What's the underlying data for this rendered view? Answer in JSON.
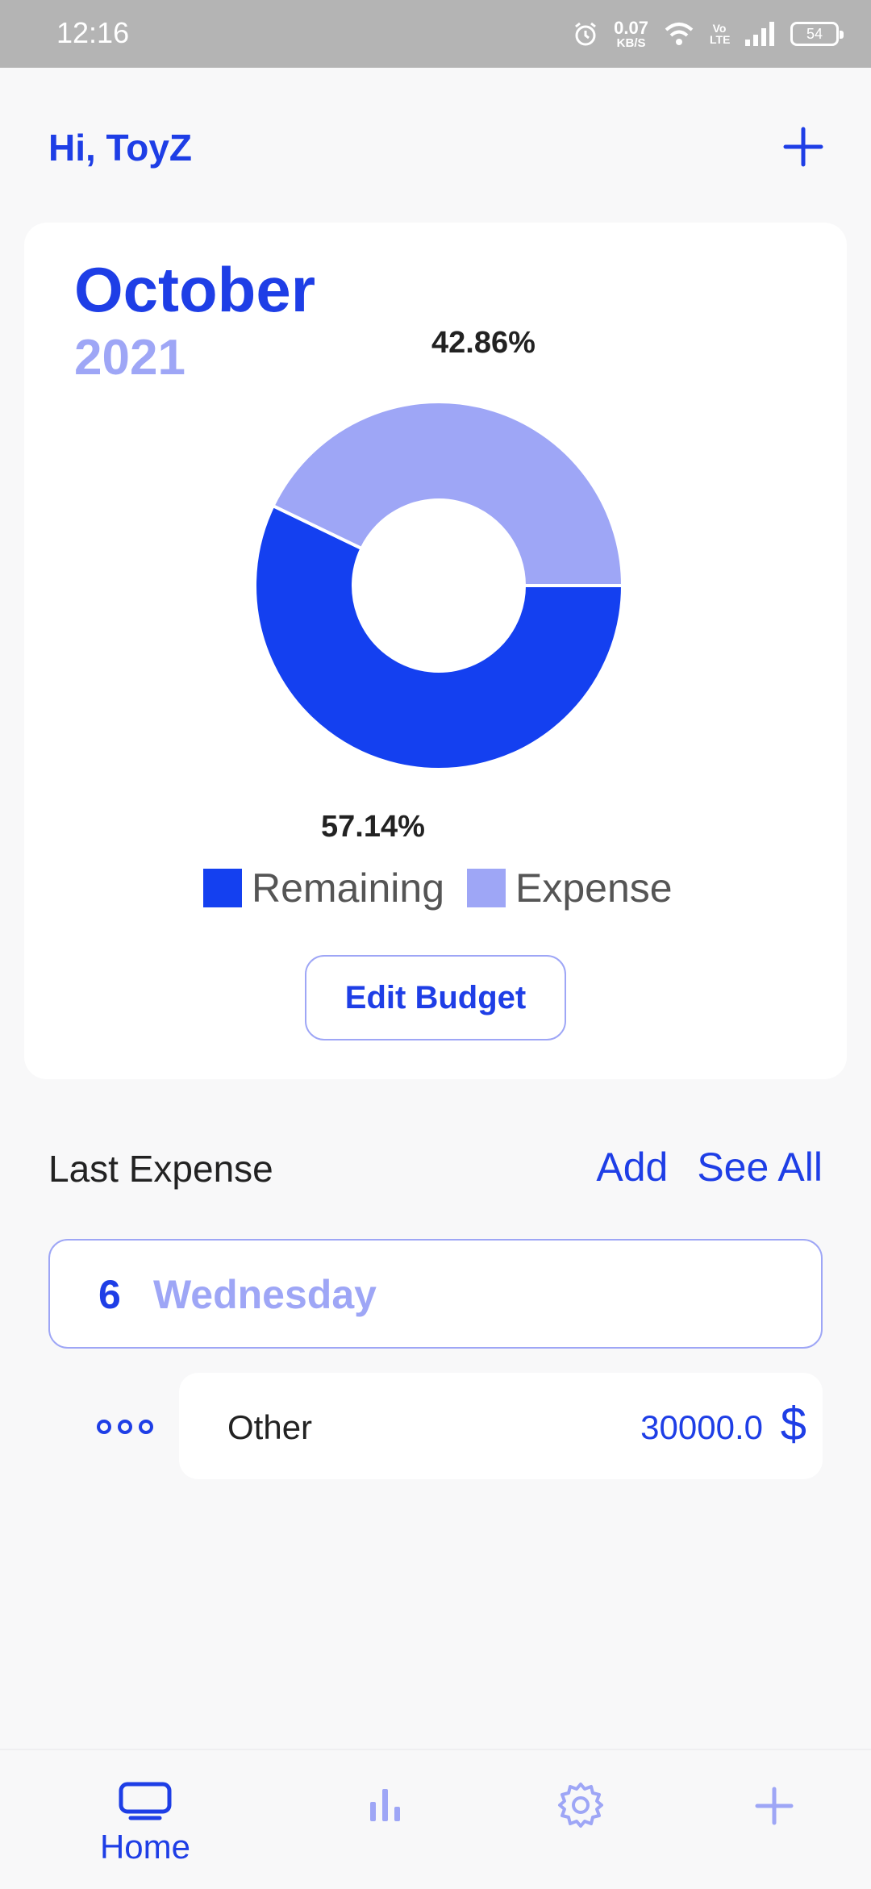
{
  "status_bar": {
    "time": "12:16",
    "net_speed_value": "0.07",
    "net_speed_unit": "KB/S",
    "network_label": "Vo LTE",
    "battery": "54"
  },
  "header": {
    "greeting": "Hi, ToyZ",
    "add_icon": "plus-icon"
  },
  "budget": {
    "month": "October",
    "year": "2021",
    "chart_data": {
      "type": "pie",
      "donut": true,
      "categories": [
        "Remaining",
        "Expense"
      ],
      "values": [
        57.14,
        42.86
      ],
      "labels": [
        "57.14%",
        "42.86%"
      ],
      "colors": [
        "#1440f0",
        "#9ea6f6"
      ],
      "legend_position": "bottom"
    },
    "legend": [
      {
        "label": "Remaining",
        "color": "#1440f0"
      },
      {
        "label": "Expense",
        "color": "#9ea6f6"
      }
    ],
    "edit_button": "Edit Budget"
  },
  "last_expense": {
    "title": "Last Expense",
    "add_label": "Add",
    "see_all_label": "See All",
    "day": {
      "number": "6",
      "name": "Wednesday"
    },
    "items": [
      {
        "category": "Other",
        "amount": "30000.0",
        "currency": "$"
      }
    ]
  },
  "bottom_nav": {
    "items": [
      {
        "label": "Home",
        "icon": "home-icon",
        "active": true
      },
      {
        "label": "",
        "icon": "stats-icon",
        "active": false
      },
      {
        "label": "",
        "icon": "settings-icon",
        "active": false
      },
      {
        "label": "",
        "icon": "plus-icon",
        "active": false
      }
    ]
  },
  "colors": {
    "primary": "#1e3ee6",
    "accent_light": "#9ea6f6",
    "background": "#f8f8f9"
  }
}
